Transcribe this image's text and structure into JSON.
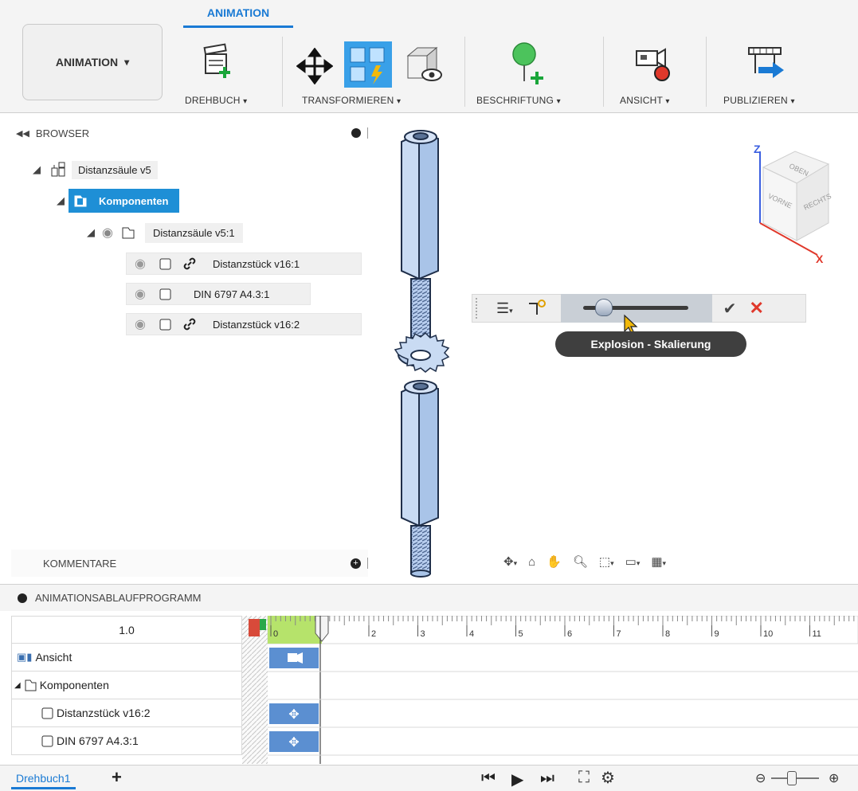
{
  "ribbon": {
    "workspace_label": "ANIMATION",
    "active_tab": "ANIMATION",
    "groups": {
      "drehbuch": "DREHBUCH",
      "transformieren": "TRANSFORMIEREN",
      "beschriftung": "BESCHRIFTUNG",
      "ansicht": "ANSICHT",
      "publizieren": "PUBLIZIEREN"
    },
    "dropdown_arrow": "▾"
  },
  "browser": {
    "title": "BROWSER",
    "tree": {
      "root": "Distanzsäule v5",
      "components": "Komponenten",
      "assembly": "Distanzsäule v5:1",
      "item1": "Distanzstück v16:1",
      "item2": "DIN 6797 A4.3:1",
      "item3": "Distanzstück v16:2"
    }
  },
  "comments": {
    "title": "KOMMENTARE"
  },
  "viewcube": {
    "axis_z": "Z",
    "axis_x": "X",
    "face_top": "OBEN",
    "face_front": "VORNE",
    "face_right": "RECHTS"
  },
  "explosion": {
    "tooltip": "Explosion - Skalierung",
    "slider_value": 0.2
  },
  "timeline": {
    "title": "ANIMATIONSABLAUFPROGRAMM",
    "speed": "1.0",
    "ruler_ticks": [
      "0",
      "2",
      "3",
      "4",
      "5",
      "6",
      "7",
      "8",
      "9",
      "10",
      "11"
    ],
    "rows": {
      "view": "Ansicht",
      "components": "Komponenten",
      "part1": "Distanzstück v16:2",
      "part2": "DIN 6797 A4.3:1"
    }
  },
  "footer": {
    "storyboard_tab": "Drehbuch1",
    "add": "+"
  },
  "colors": {
    "accent": "#1a7ad4",
    "selected": "#1e8fd6",
    "part_blue": "#a9c4e8",
    "timeline_green": "#b6e36b",
    "red": "#e0382b"
  }
}
